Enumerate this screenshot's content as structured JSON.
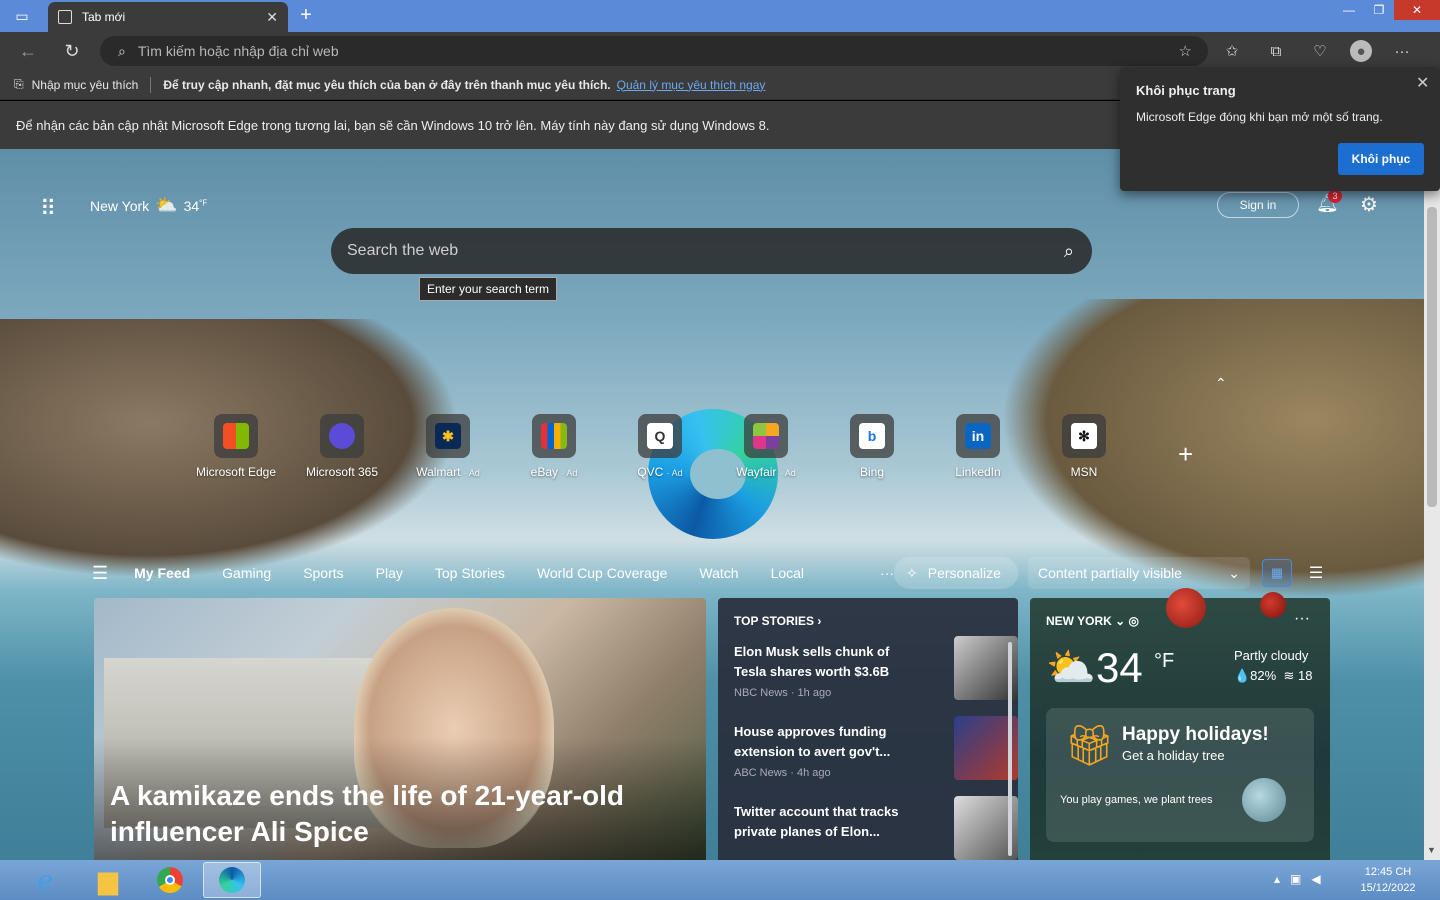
{
  "window": {
    "tab_title": "Tab mới",
    "new_tab_symbol": "+",
    "close_tab_symbol": "✕",
    "minimize_symbol": "—",
    "restore_symbol": "❐",
    "close_symbol": "✕"
  },
  "navbar": {
    "address_placeholder": "Tìm kiếm hoặc nhập địa chỉ web"
  },
  "favorites_bar": {
    "item_label": "Nhập mục yêu thích",
    "message": "Để truy cập nhanh, đặt mục yêu thích của bạn ở đây trên thanh mục yêu thích.",
    "link": "Quản lý mục yêu thích ngay"
  },
  "info_bar": {
    "message": "Để nhận các bản cập nhật Microsoft Edge trong tương lai, bạn sẽ cần Windows 10 trở lên. Máy tính này đang sử dụng Windows 8."
  },
  "restore_popup": {
    "title": "Khôi phục trang",
    "description": "Microsoft Edge đóng khi bạn mở một số trang.",
    "button": "Khôi phục"
  },
  "header": {
    "city": "New York",
    "temp": "34",
    "unit": "°F",
    "sign_in": "Sign in",
    "notification_count": "3"
  },
  "search": {
    "placeholder": "Search the web",
    "tooltip": "Enter your search term"
  },
  "tiles": [
    {
      "label": "Microsoft Edge",
      "ad": "",
      "color": "#2a2a2a"
    },
    {
      "label": "Microsoft 365",
      "ad": "",
      "color": "#5b4bd6"
    },
    {
      "label": "Walmart",
      "ad": "· Ad",
      "color": "#0071ce"
    },
    {
      "label": "eBay",
      "ad": "· Ad",
      "color": "#333333"
    },
    {
      "label": "QVC",
      "ad": "· Ad",
      "color": "#ffffff"
    },
    {
      "label": "Wayfair",
      "ad": "· Ad",
      "color": "#7b3f9e"
    },
    {
      "label": "Bing",
      "ad": "",
      "color": "#ffffff"
    },
    {
      "label": "LinkedIn",
      "ad": "",
      "color": "#0a66c2"
    },
    {
      "label": "MSN",
      "ad": "",
      "color": "#ffffff"
    }
  ],
  "feed_nav": {
    "items": [
      "My Feed",
      "Gaming",
      "Sports",
      "Play",
      "Top Stories",
      "World Cup Coverage",
      "Watch",
      "Local"
    ],
    "more": "···",
    "personalize": "Personalize",
    "content_visibility": "Content partially visible"
  },
  "main_card": {
    "headline": "A kamikaze ends the life of 21-year-old influencer Ali Spice"
  },
  "top_stories": {
    "heading": "TOP STORIES",
    "items": [
      {
        "title": "Elon Musk sells chunk of Tesla shares worth $3.6B",
        "source": "NBC News · 1h ago"
      },
      {
        "title": "House approves funding extension to avert gov't...",
        "source": "ABC News · 4h ago"
      },
      {
        "title": "Twitter account that tracks private planes of Elon...",
        "source": ""
      }
    ]
  },
  "weather_card": {
    "location": "NEW YORK",
    "temp": "34",
    "unit": "°F",
    "condition": "Partly cloudy",
    "humidity": "💧82%",
    "aqi": "18",
    "promo_title": "Happy holidays!",
    "promo_subtitle": "Get a holiday tree",
    "promo_text": "You play games, we plant trees"
  },
  "taskbar": {
    "time": "12:45 CH",
    "date": "15/12/2022"
  }
}
